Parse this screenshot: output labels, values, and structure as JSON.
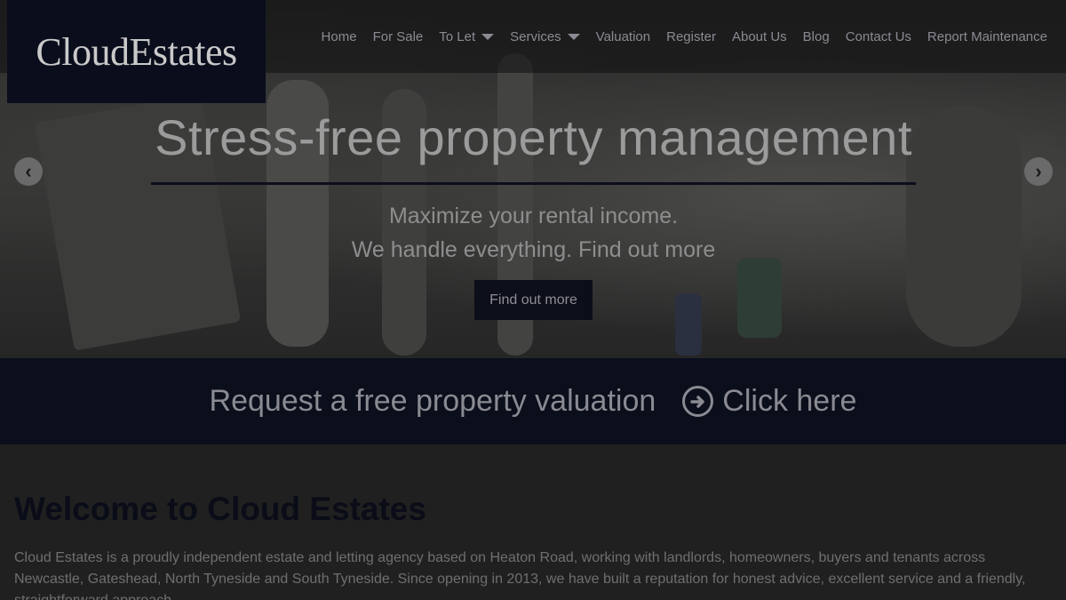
{
  "brand": {
    "logo": "CloudEstates"
  },
  "nav": {
    "items": [
      {
        "label": "Home",
        "dropdown": false
      },
      {
        "label": "For Sale",
        "dropdown": false
      },
      {
        "label": "To Let",
        "dropdown": true
      },
      {
        "label": "Services",
        "dropdown": true
      },
      {
        "label": "Valuation",
        "dropdown": false
      },
      {
        "label": "Register",
        "dropdown": false
      },
      {
        "label": "About Us",
        "dropdown": false
      },
      {
        "label": "Blog",
        "dropdown": false
      },
      {
        "label": "Contact Us",
        "dropdown": false
      },
      {
        "label": "Report Maintenance",
        "dropdown": false
      }
    ]
  },
  "hero": {
    "title": "Stress-free property management",
    "subtitle_line1": "Maximize your rental income.",
    "subtitle_line2": "We handle everything. Find out more",
    "button": "Find out more",
    "prev_icon": "chevron-left-icon",
    "next_icon": "chevron-right-icon"
  },
  "banner": {
    "text": "Request a free property valuation",
    "link": "Click here",
    "icon": "circle-arrow-right-icon"
  },
  "content": {
    "heading": "Welcome to Cloud Estates",
    "intro": "Cloud Estates is a proudly independent estate and letting agency based on Heaton Road, working with landlords, homeowners, buyers and tenants across Newcastle, Gateshead, North Tyneside and South Tyneside. Since opening in 2013, we have built a reputation for honest advice, excellent service and a friendly, straightforward approach."
  },
  "colors": {
    "navy": "#0b0e1b",
    "overlay": "#1a1a1a"
  }
}
